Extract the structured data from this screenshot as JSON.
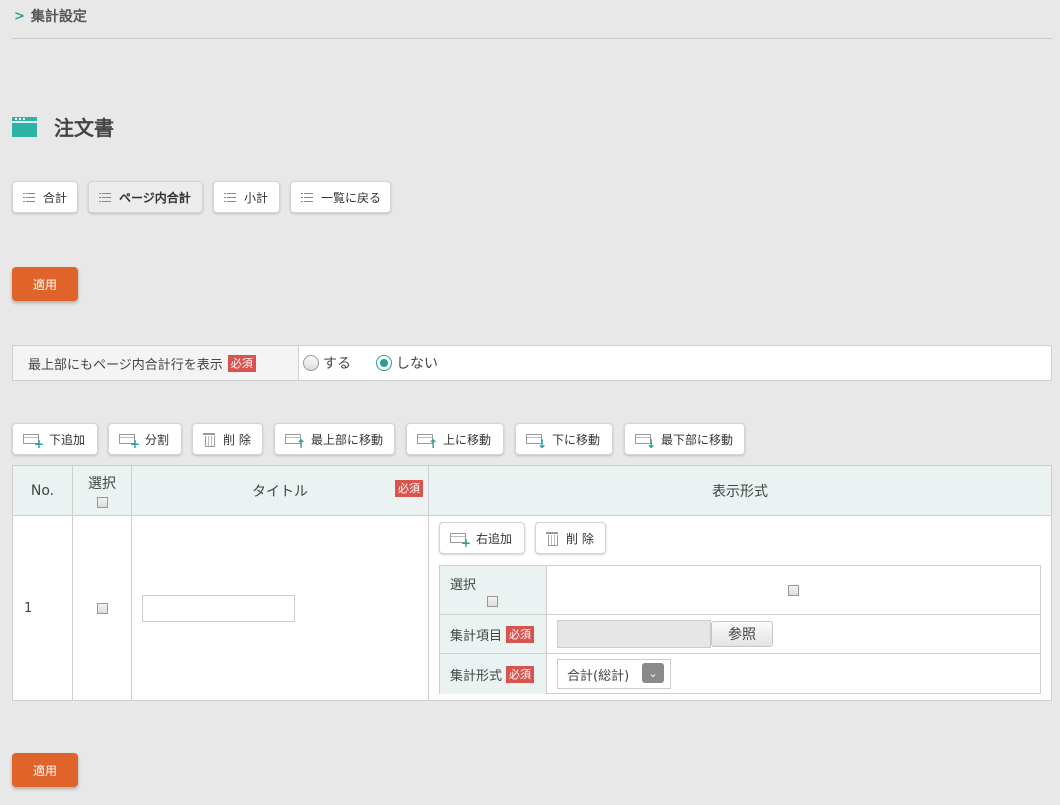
{
  "breadcrumb": {
    "label": "集計設定"
  },
  "page_title": "注文書",
  "top_tabs": [
    {
      "label": "合計",
      "active": false
    },
    {
      "label": "ページ内合計",
      "active": true
    },
    {
      "label": "小計",
      "active": false
    },
    {
      "label": "一覧に戻る",
      "active": false
    }
  ],
  "apply_label": "適用",
  "required_label": "必須",
  "option_row": {
    "label": "最上部にもページ内合計行を表示",
    "options": [
      {
        "label": "する",
        "selected": false
      },
      {
        "label": "しない",
        "selected": true
      }
    ]
  },
  "toolbar": {
    "add_below": "下追加",
    "split": "分割",
    "delete": "削 除",
    "move_top": "最上部に移動",
    "move_up": "上に移動",
    "move_down": "下に移動",
    "move_bottom": "最下部に移動"
  },
  "table": {
    "headers": {
      "no": "No.",
      "select": "選択",
      "title": "タイトル",
      "display_format": "表示形式"
    },
    "rows": [
      {
        "no": "1",
        "title_value": ""
      }
    ]
  },
  "inner": {
    "add_right": "右追加",
    "delete": "削 除",
    "select_label": "選択",
    "item_label": "集計項目",
    "item_value": "",
    "ref_button": "参照",
    "format_label": "集計形式",
    "format_value": "合計(総計)"
  },
  "colors": {
    "accent": "#2aa198",
    "orange": "#e0642a",
    "required": "#d9534f"
  }
}
